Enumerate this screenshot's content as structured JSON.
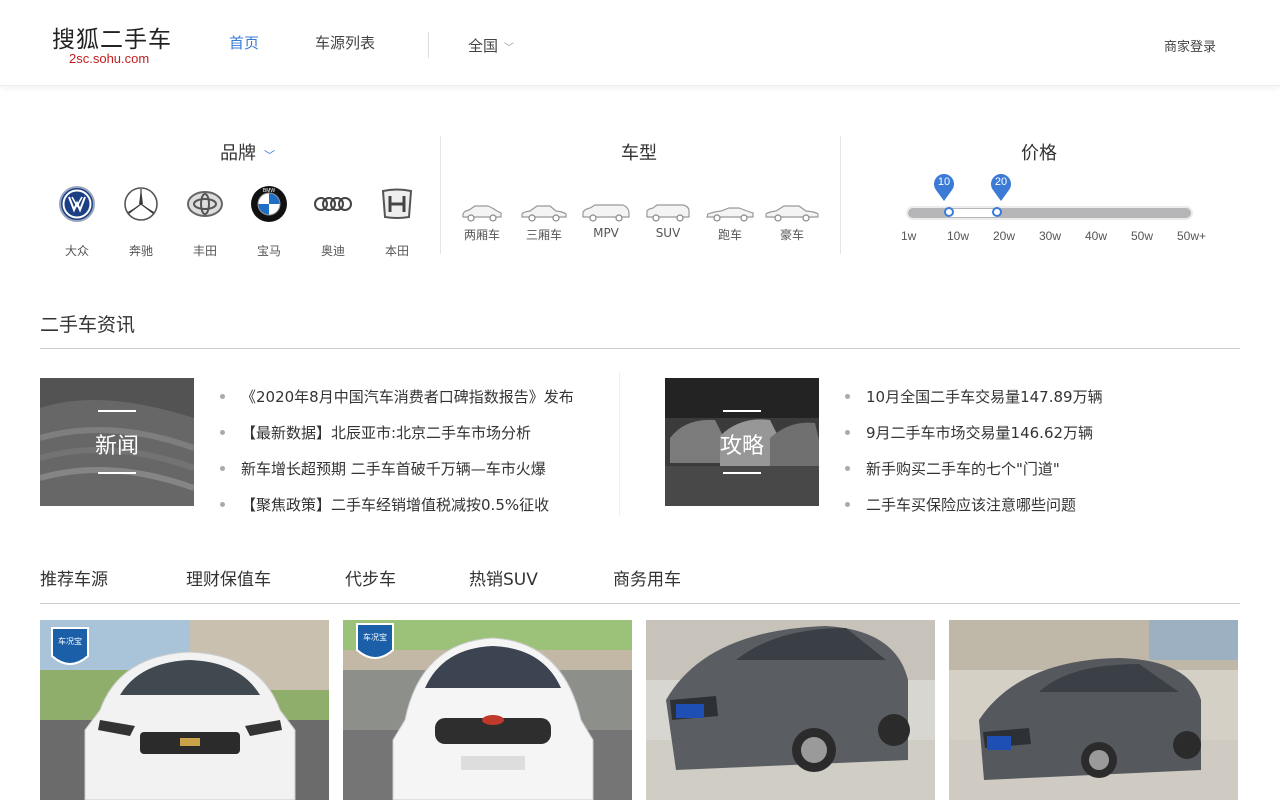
{
  "header": {
    "logo_main": "搜狐二手车",
    "logo_sub": "2sc.sohu.com",
    "nav": {
      "home": "首页",
      "list": "车源列表"
    },
    "city": "全国",
    "login": "商家登录"
  },
  "filters": {
    "brand_title": "品牌",
    "type_title": "车型",
    "price_title": "价格",
    "brands": [
      {
        "label": "大众",
        "icon": "volkswagen-logo-icon"
      },
      {
        "label": "奔驰",
        "icon": "mercedes-logo-icon"
      },
      {
        "label": "丰田",
        "icon": "toyota-logo-icon"
      },
      {
        "label": "宝马",
        "icon": "bmw-logo-icon"
      },
      {
        "label": "奥迪",
        "icon": "audi-logo-icon"
      },
      {
        "label": "本田",
        "icon": "honda-logo-icon"
      }
    ],
    "car_types": [
      {
        "label": "两厢车",
        "icon": "hatchback-icon"
      },
      {
        "label": "三厢车",
        "icon": "sedan-icon"
      },
      {
        "label": "MPV",
        "icon": "mpv-icon"
      },
      {
        "label": "SUV",
        "icon": "suv-icon"
      },
      {
        "label": "跑车",
        "icon": "sports-car-icon"
      },
      {
        "label": "豪车",
        "icon": "luxury-car-icon"
      }
    ],
    "price": {
      "min_label": "10",
      "max_label": "20",
      "ticks": [
        "1w",
        "10w",
        "20w",
        "30w",
        "40w",
        "50w",
        "50w+"
      ],
      "selected_min": 10,
      "selected_max": 20
    }
  },
  "news": {
    "title": "二手车资讯",
    "news_block": {
      "image_label": "新闻",
      "items": [
        "《2020年8月中国汽车消费者口碑指数报告》发布",
        "【最新数据】北辰亚市:北京二手车市场分析",
        "新车增长超预期 二手车首破千万辆—车市火爆",
        "【聚焦政策】二手车经销增值税减按0.5%征收"
      ]
    },
    "guide_block": {
      "image_label": "攻略",
      "items": [
        "10月全国二手车交易量147.89万辆",
        "9月二手车市场交易量146.62万辆",
        "新手购买二手车的七个\"门道\"",
        "二手车买保险应该注意哪些问题"
      ]
    }
  },
  "recommend": {
    "tabs": [
      "推荐车源",
      "理财保值车",
      "代步车",
      "热销SUV",
      "商务用车"
    ],
    "cars": [
      {
        "badge": "车况宝",
        "color": "#f2f2f2"
      },
      {
        "badge": "车况宝",
        "color": "#f5f5f5"
      },
      {
        "badge": "",
        "color": "#5a5e63"
      },
      {
        "badge": "",
        "color": "#55595e"
      }
    ]
  }
}
